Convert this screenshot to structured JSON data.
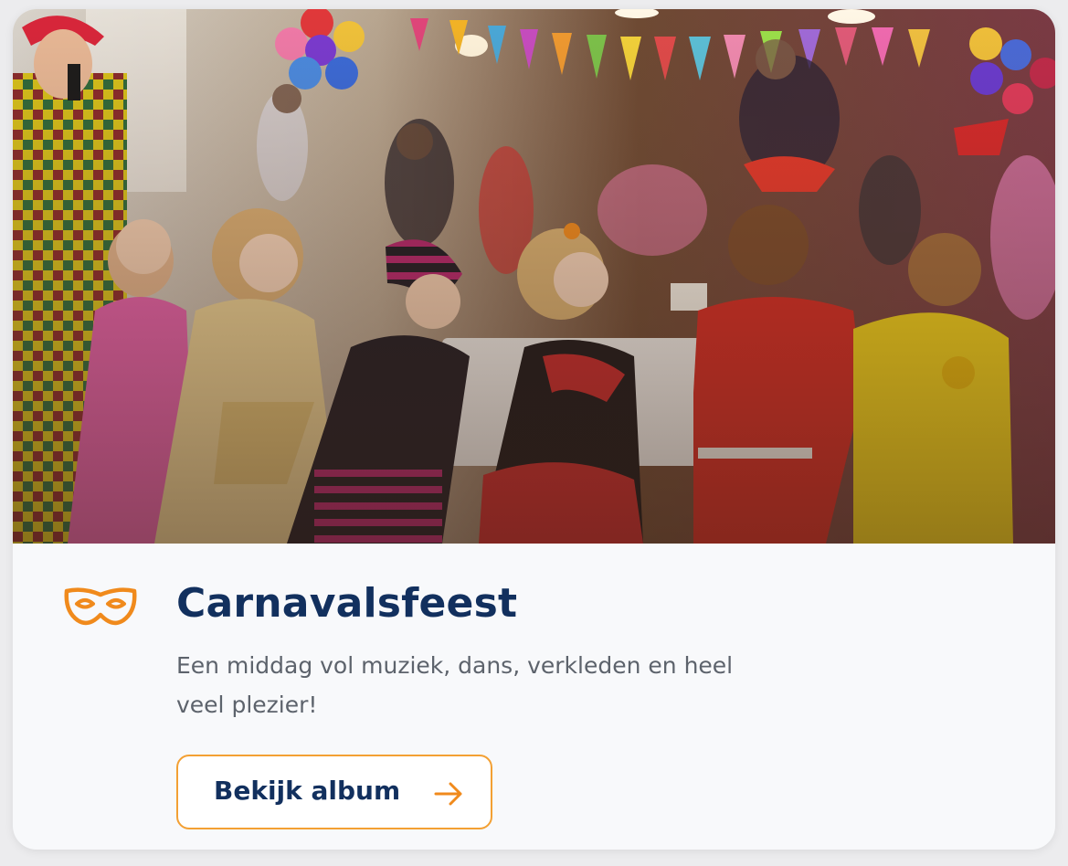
{
  "event": {
    "title": "Carnavalsfeest",
    "description": "Een middag vol muziek, dans, verkleden en heel veel plezier!",
    "icon": "carnival-mask-icon",
    "photo_subject": ""
  },
  "actions": {
    "album_label": "Bekijk album",
    "album_icon": "arrow-right-icon"
  },
  "colors": {
    "accent": "#f08a1c",
    "title": "#12305e",
    "text": "#5d636c",
    "card": "#f8f9fb"
  }
}
